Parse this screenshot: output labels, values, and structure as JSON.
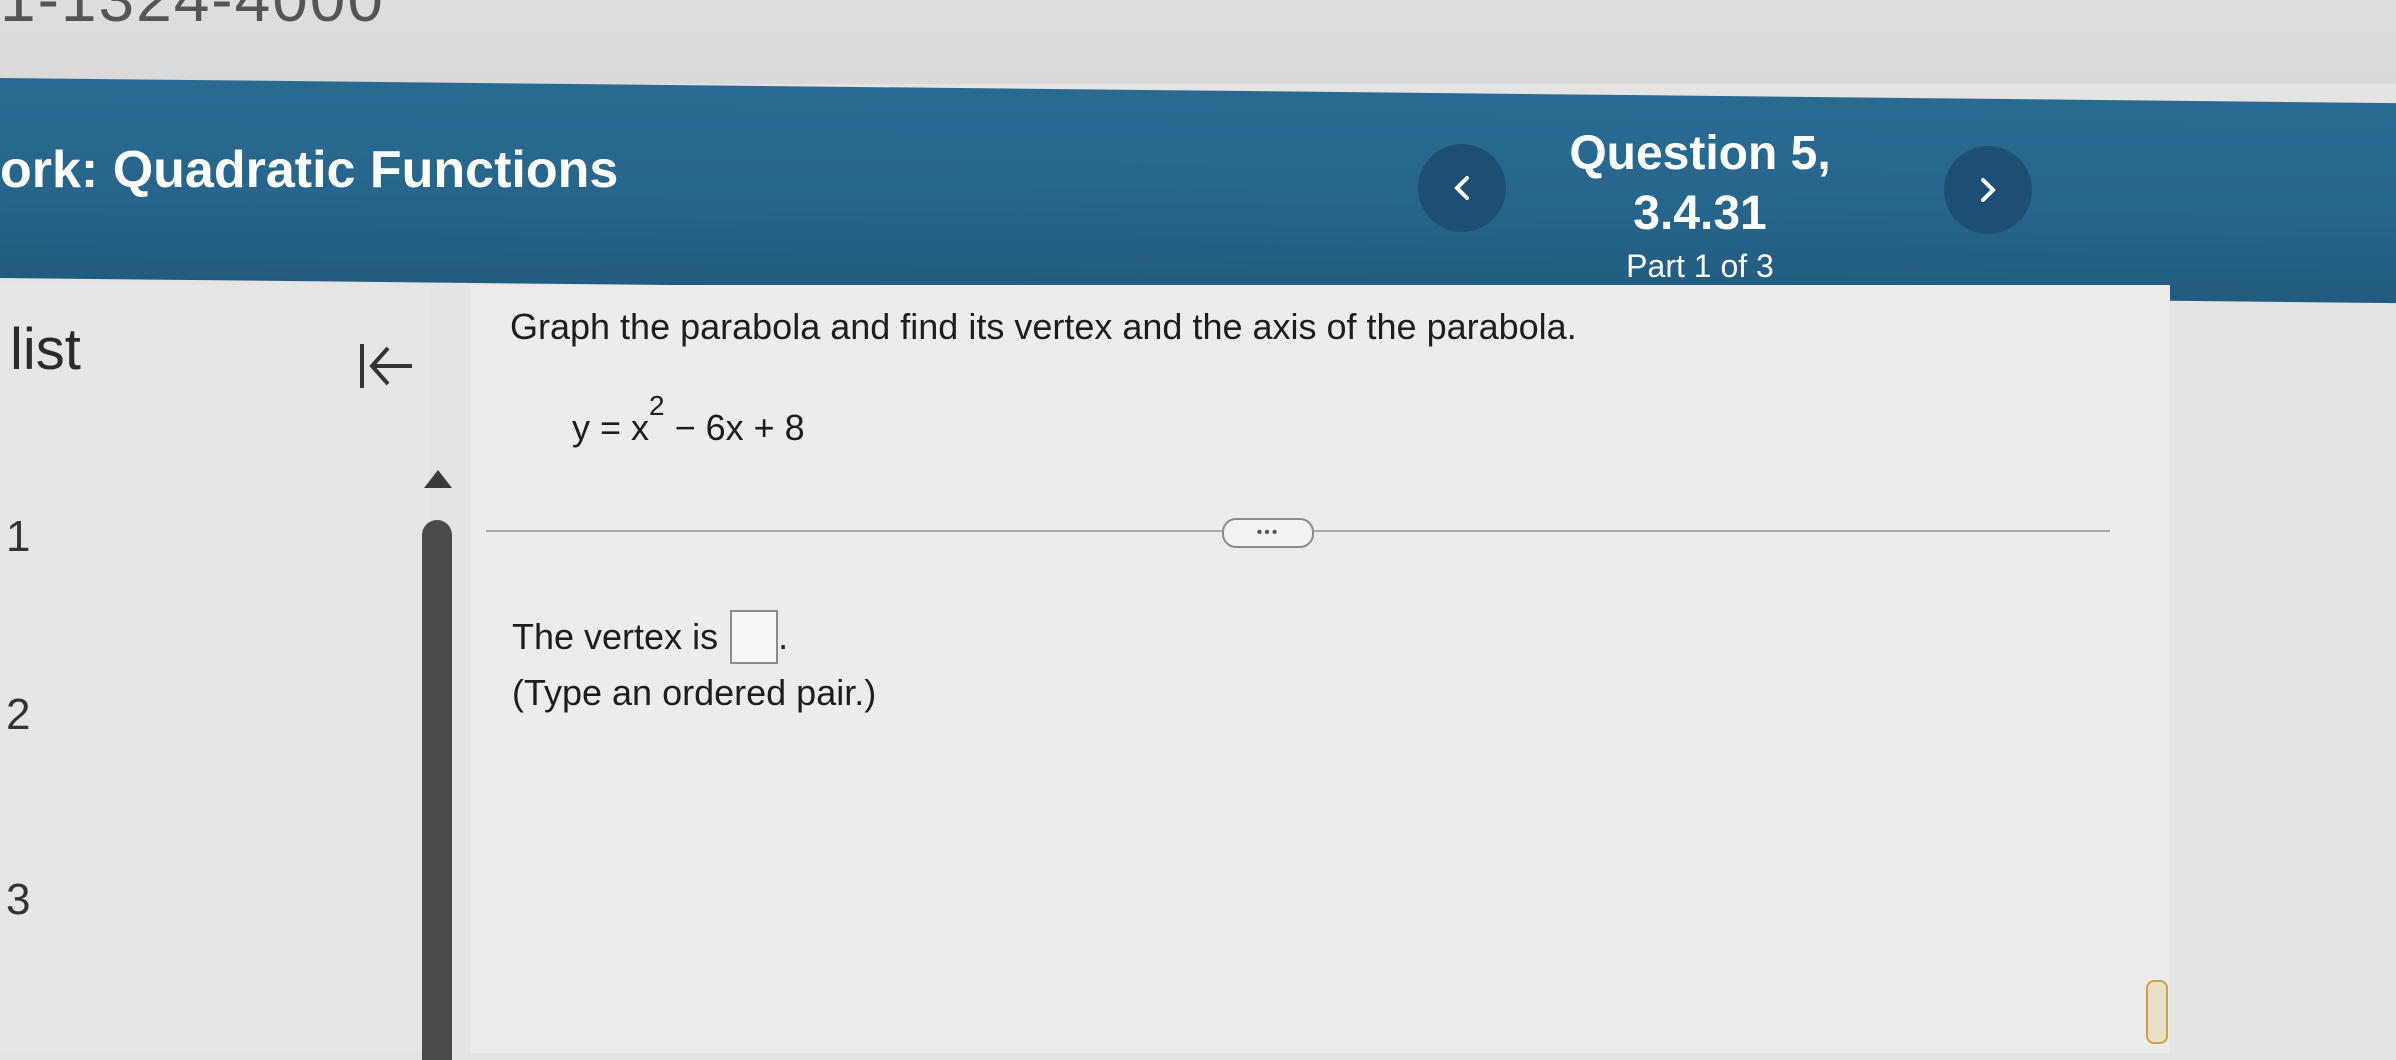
{
  "top_strip": {
    "cut_text": "1-1324-4000"
  },
  "header": {
    "title_prefix": "ork:",
    "title": "Quadratic Functions",
    "question_title": "Question 5, 3.4.31",
    "question_part": "Part 1 of 3",
    "prev_icon": "chevron-left-icon",
    "next_icon": "chevron-right-icon"
  },
  "sidebar": {
    "heading": "list",
    "collapse_icon": "collapse-left-icon",
    "items": [
      "1",
      "2",
      "3"
    ]
  },
  "question": {
    "prompt": "Graph the parabola and find its vertex and the axis of the parabola.",
    "equation_lhs": "y = x",
    "equation_exp": "2",
    "equation_rhs": " − 6x + 8",
    "more_label": "•••",
    "vertex_label": "The vertex is",
    "vertex_value": "",
    "vertex_suffix": ".",
    "hint": "(Type an ordered pair.)"
  }
}
